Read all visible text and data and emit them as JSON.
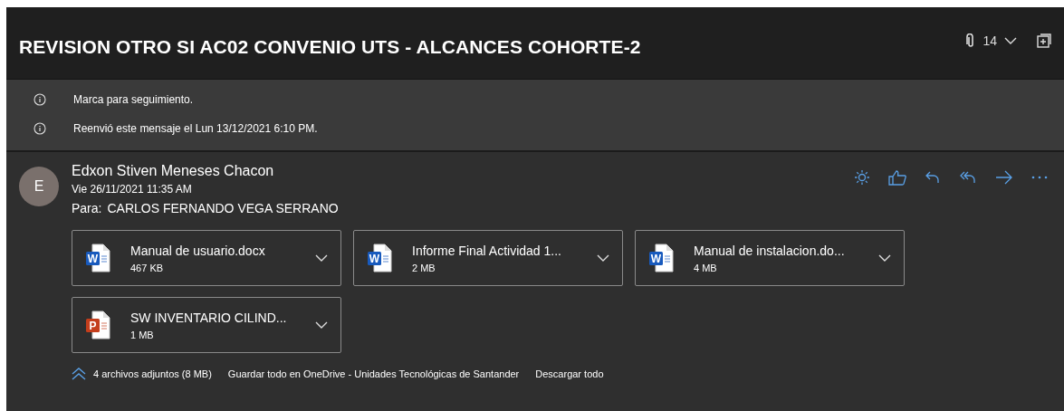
{
  "subject": "REVISION OTRO SI AC02 CONVENIO UTS - ALCANCES COHORTE-2",
  "thread_count": "14",
  "notices": [
    "Marca para seguimiento.",
    "Reenvió este mensaje el Lun 13/12/2021 6:10 PM."
  ],
  "message": {
    "avatar_initial": "E",
    "sender": "Edxon Stiven Meneses Chacon",
    "date": "Vie 26/11/2021 11:35 AM",
    "to_label": "Para:",
    "to": "CARLOS FERNANDO VEGA SERRANO"
  },
  "attachments": [
    {
      "kind": "word",
      "icon_letter": "W",
      "name": "Manual de usuario.docx",
      "size": "467 KB"
    },
    {
      "kind": "word",
      "icon_letter": "W",
      "name": "Informe Final Actividad 1...",
      "size": "2 MB"
    },
    {
      "kind": "word",
      "icon_letter": "W",
      "name": "Manual de instalacion.do...",
      "size": "4 MB"
    },
    {
      "kind": "powerpoint",
      "icon_letter": "P",
      "name": "SW INVENTARIO CILIND...",
      "size": "1 MB"
    }
  ],
  "attachments_footer": {
    "summary": "4 archivos adjuntos (8 MB)",
    "save_all": "Guardar todo en OneDrive - Unidades Tecnológicas de Santander",
    "download_all": "Descargar todo"
  }
}
